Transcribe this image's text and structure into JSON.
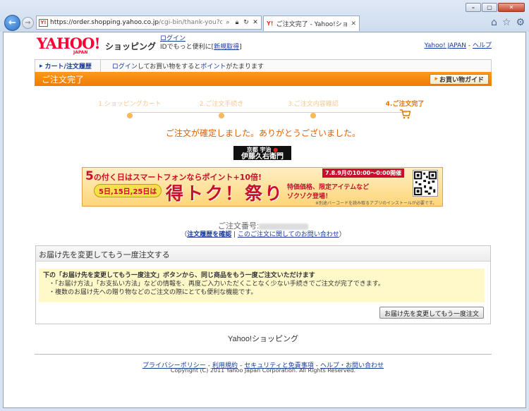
{
  "browser": {
    "url_host": "https://order.shopping.yahoo.co.jp",
    "url_path": "/cgi-bin/thank-you?catalog",
    "tab_title": "ご注文完了 - Yahoo!ショ...",
    "tab_favicon": "Y!",
    "addr_favicon": "Y!",
    "icons": [
      "back-arrow-icon",
      "forward-arrow-icon",
      "search-icon",
      "lock-icon",
      "refresh-icon",
      "close-icon",
      "home-icon",
      "star-icon",
      "gear-icon"
    ]
  },
  "header": {
    "logo_text": "YAHOO!",
    "logo_sub": "JAPAN",
    "service_name": "ショッピング",
    "login_link": "ログイン",
    "login_note": "IDでもっと便利に[",
    "register_link": "新規取得",
    "login_note_end": "]",
    "yahoo_japan_link": "Yahoo! JAPAN",
    "help_sep": " - ",
    "help_link": "ヘルプ"
  },
  "navbar": {
    "cart_label": "カート/注文履歴",
    "msg_login": "ログイン",
    "msg_mid": "してお買い物をすると",
    "msg_point": "ポイント",
    "msg_end": "がたまります"
  },
  "titlebar": {
    "title": "ご注文完了",
    "guide_button": "お買い物ガイド"
  },
  "steps": [
    {
      "label": "1.ショッピングカート"
    },
    {
      "label": "2.ご注文手続き"
    },
    {
      "label": "3.ご注文内容確認"
    },
    {
      "label": "4.ご注文完了"
    }
  ],
  "confirmation": "ご注文が確定しました。ありがとうございました。",
  "shop_logo": {
    "line1": "京都 宇治",
    "line2": "伊藤久右衛門"
  },
  "banner": {
    "top_num": "5",
    "top_text": "の付く日はスマートフォンならポイント+10倍!",
    "pill": "5日,15日,25日は",
    "title": "得トク！祭り",
    "hours": "7.8.9月の10:00～0:00開催",
    "sub1": "特価価格、限定アイテムなど",
    "sub2": "ゾクゾク登場！",
    "note": "※別途バーコードを読み取るアプリのインストールが必要です。"
  },
  "order": {
    "number_label": "ご注文番号:",
    "links_open": "（",
    "history_link": "注文履歴を確認",
    "links_sep": " | ",
    "inquiry_link": "このご注文に関してのお問い合わせ",
    "links_close": "）"
  },
  "reorder": {
    "heading": "お届け先を変更してもう一度注文する",
    "lead": "下の「お届け先を変更してもう一度注文」ボタンから、同じ商品をもう一度ご注文いただけます",
    "item1": "・「お届け方法」「お支払い方法」などの情報を、再度ご入力いただくことなく少ない手続きでご注文が完了できます。",
    "item2": "・複数のお届け先への贈り物などのご注文の際にとても便利な機能です。",
    "button": "お届け先を変更してもう一度注文"
  },
  "footer": {
    "title": "Yahoo!ショッピング",
    "links": [
      "プライバシーポリシー",
      "利用規約",
      "セキュリティと免責事項",
      "ヘルプ・お問い合わせ"
    ],
    "sep": "-",
    "copyright": "Copyright (C) 2011 Yahoo Japan Corporation. All Rights Reserved."
  },
  "colors": {
    "accent_orange": "#f07a06",
    "link_blue": "#1a3b9c",
    "confirm_text": "#e05f00",
    "yahoo_red": "#ff0033"
  }
}
